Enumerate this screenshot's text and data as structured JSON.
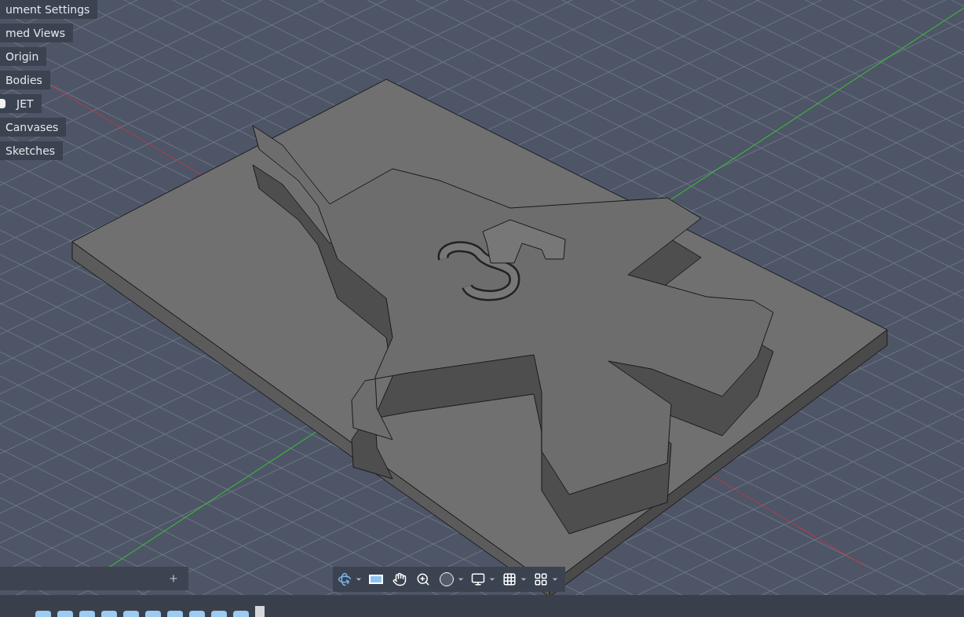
{
  "browser": {
    "items": [
      {
        "label": "ument Settings",
        "kind": "folder"
      },
      {
        "label": "med Views",
        "kind": "folder"
      },
      {
        "label": "Origin",
        "kind": "folder"
      },
      {
        "label": "Bodies",
        "kind": "folder"
      },
      {
        "label": "JET",
        "kind": "body"
      },
      {
        "label": "Canvases",
        "kind": "folder"
      },
      {
        "label": "Sketches",
        "kind": "folder"
      }
    ]
  }
}
